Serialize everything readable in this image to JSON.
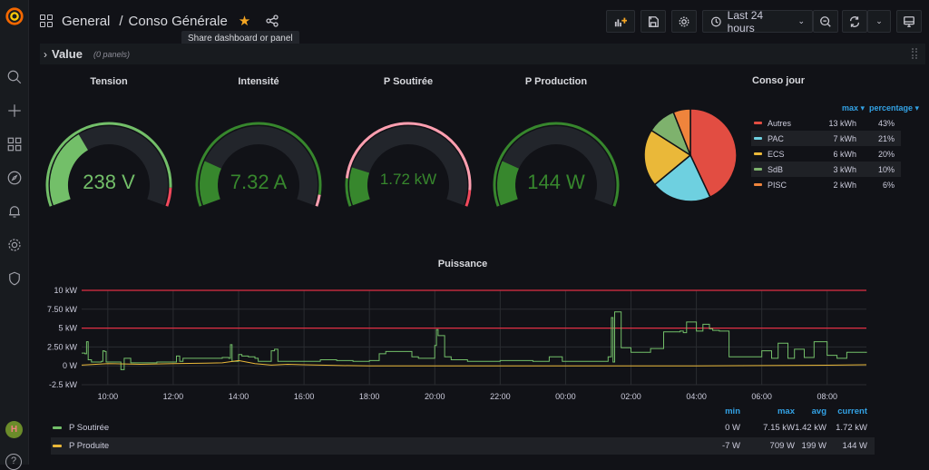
{
  "sidebar": {
    "items": [
      {
        "name": "search",
        "icon": "search-icon"
      },
      {
        "name": "create",
        "icon": "plus-icon"
      },
      {
        "name": "dashboards",
        "icon": "grid-icon"
      },
      {
        "name": "explore",
        "icon": "compass-icon"
      },
      {
        "name": "alerting",
        "icon": "bell-icon"
      },
      {
        "name": "configuration",
        "icon": "gear-icon"
      },
      {
        "name": "server-admin",
        "icon": "shield-icon"
      }
    ],
    "avatar_initials": "H",
    "help_label": "?"
  },
  "header": {
    "folder": "General",
    "separator": "/",
    "title": "Conso Générale",
    "tooltip": "Share dashboard or panel",
    "time_range": "Last 24 hours"
  },
  "row": {
    "chevron": "›",
    "title": "Value",
    "panel_count": "(0 panels)"
  },
  "gauges": [
    {
      "title": "Tension",
      "value": "238 V",
      "fraction": 0.36,
      "color": "#73bf69",
      "text_color": "#73bf69"
    },
    {
      "title": "Intensité",
      "value": "7.32 A",
      "fraction": 0.2,
      "color": "#37872d",
      "text_color": "#37872d"
    },
    {
      "title": "P Soutirée",
      "value": "1.72 kW",
      "fraction": 0.17,
      "color": "#37872d",
      "text_color": "#37872d"
    },
    {
      "title": "P Production",
      "value": "144 W",
      "fraction": 0.2,
      "color": "#37872d",
      "text_color": "#37872d"
    }
  ],
  "pie": {
    "title": "Conso jour",
    "headers": {
      "max": "max ▾",
      "percentage": "percentage ▾"
    },
    "slices": [
      {
        "label": "Autres",
        "max": "13 kWh",
        "percentage": "43%",
        "value": 43,
        "color": "#e24d42"
      },
      {
        "label": "PAC",
        "max": "7 kWh",
        "percentage": "21%",
        "value": 21,
        "color": "#6ed0e0"
      },
      {
        "label": "ECS",
        "max": "6 kWh",
        "percentage": "20%",
        "value": 20,
        "color": "#eab839"
      },
      {
        "label": "SdB",
        "max": "3 kWh",
        "percentage": "10%",
        "value": 10,
        "color": "#7eb26d"
      },
      {
        "label": "PISC",
        "max": "2 kWh",
        "percentage": "6%",
        "value": 6,
        "color": "#ef843c"
      }
    ]
  },
  "chart_data": {
    "type": "line",
    "title": "Puissance",
    "xlabel": "",
    "ylabel": "",
    "x_ticks": [
      "10:00",
      "12:00",
      "14:00",
      "16:00",
      "18:00",
      "20:00",
      "22:00",
      "00:00",
      "02:00",
      "04:00",
      "06:00",
      "08:00"
    ],
    "y_ticks": [
      "10 kW",
      "7.50 kW",
      "5 kW",
      "2.50 kW",
      "0 W",
      "-2.5 kW"
    ],
    "ylim_kw": [
      -2.5,
      10
    ],
    "x_range_hours": [
      9.2,
      33.2
    ],
    "grid": true,
    "thresholds_kw": [
      5,
      10
    ],
    "threshold_color": "#e02f44",
    "series": [
      {
        "name": "P Soutirée",
        "color": "#73bf69",
        "x_hours": [
          9.2,
          9.3,
          9.35,
          9.4,
          9.5,
          9.8,
          9.85,
          9.9,
          9.95,
          10.4,
          10.5,
          10.7,
          11.5,
          12.0,
          12.1,
          12.2,
          12.3,
          13.0,
          13.5,
          13.7,
          13.75,
          13.8,
          14.0,
          14.1,
          14.3,
          14.5,
          14.6,
          15.0,
          15.1,
          15.2,
          16.0,
          16.5,
          17.0,
          17.5,
          18.0,
          18.3,
          18.5,
          19.0,
          19.3,
          19.5,
          19.9,
          20.0,
          20.05,
          20.1,
          20.3,
          20.5,
          21.0,
          22.0,
          23.0,
          23.5,
          23.9,
          24.5,
          25.0,
          25.3,
          25.4,
          25.45,
          25.5,
          25.7,
          26.0,
          26.5,
          26.6,
          27.0,
          27.5,
          27.6,
          27.7,
          28.0,
          28.2,
          28.4,
          28.5,
          28.7,
          29.0,
          29.5,
          30.0,
          30.3,
          30.5,
          30.8,
          31.0,
          31.3,
          31.6,
          32.0,
          32.3,
          32.6,
          33.2
        ],
        "y_kw": [
          1.7,
          1.6,
          3.2,
          0.8,
          0.5,
          0.6,
          2.0,
          1.9,
          0.5,
          -0.5,
          1.0,
          0.4,
          0.5,
          0.5,
          1.3,
          0.6,
          1.0,
          1.0,
          1.1,
          1.0,
          2.8,
          0.6,
          1.5,
          1.3,
          1.2,
          1.0,
          0.6,
          2.0,
          2.2,
          0.6,
          0.6,
          0.8,
          0.7,
          0.6,
          0.7,
          1.6,
          1.9,
          1.9,
          1.2,
          1.0,
          1.0,
          2.7,
          4.8,
          4.0,
          1.2,
          0.8,
          0.6,
          0.7,
          0.6,
          1.2,
          0.6,
          0.6,
          0.6,
          1.2,
          6.4,
          0.5,
          7.15,
          2.4,
          1.8,
          1.8,
          2.3,
          4.5,
          4.6,
          4.4,
          5.8,
          4.6,
          5.5,
          4.9,
          4.7,
          4.6,
          1.2,
          1.2,
          2.0,
          1.0,
          3.0,
          1.0,
          2.2,
          1.1,
          3.2,
          1.4,
          1.0,
          1.8,
          1.72
        ]
      },
      {
        "name": "P Produite",
        "color": "#eab839",
        "x_hours": [
          9.2,
          10.0,
          11.0,
          12.0,
          13.0,
          13.5,
          14.0,
          14.5,
          15.0,
          15.5,
          16.0,
          17.0,
          18.0,
          20.0,
          24.0,
          28.0,
          32.0,
          33.2
        ],
        "y_kw": [
          0.1,
          0.3,
          0.2,
          0.3,
          0.35,
          0.4,
          0.7,
          0.3,
          0.1,
          0.2,
          0.15,
          0.05,
          -0.007,
          -0.007,
          -0.007,
          0.0,
          0.08,
          0.144
        ]
      }
    ]
  },
  "ts_legend": {
    "headers": [
      "min",
      "max",
      "avg",
      "current"
    ],
    "rows": [
      {
        "name": "P Soutirée",
        "color": "#73bf69",
        "values": [
          "0 W",
          "7.15 kW",
          "1.42 kW",
          "1.72 kW"
        ]
      },
      {
        "name": "P Produite",
        "color": "#eab839",
        "values": [
          "-7 W",
          "709 W",
          "199 W",
          "144 W"
        ]
      }
    ]
  }
}
